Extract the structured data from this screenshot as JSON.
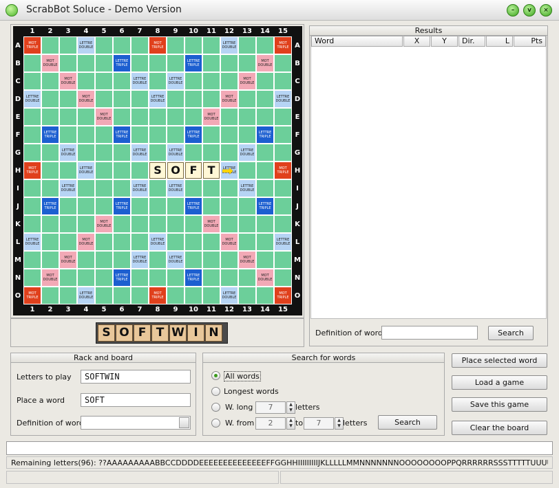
{
  "window": {
    "title": "ScrabBot Soluce -  Demo Version"
  },
  "board": {
    "columns": [
      "1",
      "2",
      "3",
      "4",
      "5",
      "6",
      "7",
      "8",
      "9",
      "10",
      "11",
      "12",
      "13",
      "14",
      "15"
    ],
    "rows": [
      "A",
      "B",
      "C",
      "D",
      "E",
      "F",
      "G",
      "H",
      "I",
      "J",
      "K",
      "L",
      "M",
      "N",
      "O"
    ],
    "bonus_labels": {
      "tt": [
        "MOT",
        "TRIPLE"
      ],
      "mt": [
        "MOT",
        "DOUBLE"
      ],
      "lt": [
        "LETTRE",
        "TRIPLE"
      ],
      "ld": [
        "LETTRE",
        "DOUBLE"
      ]
    },
    "placed_word": [
      "S",
      "O",
      "F",
      "T"
    ],
    "colors": {
      "board": "#6ccf9a",
      "mot_double": "#f2a9b6",
      "lettre_double": "#b6d4f4",
      "lettre_triple": "#1c5fd0",
      "mot_triple": "#e0401c"
    }
  },
  "rack": [
    "S",
    "O",
    "F",
    "T",
    "W",
    "I",
    "N"
  ],
  "results": {
    "title": "Results",
    "columns": [
      "Word",
      "X",
      "Y",
      "Dir.",
      "L",
      "Pts"
    ],
    "definition_label": "Definition of word",
    "definition_value": "",
    "search_label": "Search"
  },
  "rack_board": {
    "title": "Rack and board",
    "letters_label": "Letters to play",
    "letters_value": "SOFTWIN",
    "place_label": "Place a word",
    "place_value": "SOFT",
    "definition_label": "Definition of word",
    "definition_value": ""
  },
  "search": {
    "title": "Search for words",
    "all_words": "All words",
    "longest_words": "Longest words",
    "w_long": "W. long",
    "w_long_value": "7",
    "letters_label": "letters",
    "w_from": "W. from",
    "from_value": "2",
    "to_label": "to",
    "to_value": "7",
    "letters_label2": "letters",
    "search_button": "Search"
  },
  "actions": {
    "place_selected": "Place selected word",
    "load_game": "Load a game",
    "save_game": "Save this game",
    "clear_board": "Clear the board"
  },
  "status": {
    "remaining": "Remaining letters(96): ??AAAAAAAAABBCCDDDDEEEEEEEEEEEEEEFFGGHHIIIIIIIIIJKLLLLLMMNNNNNNNOOOOOOOOPPQRRRRRRSSSTTTTTUUUUUVVWWXYYZ"
  }
}
